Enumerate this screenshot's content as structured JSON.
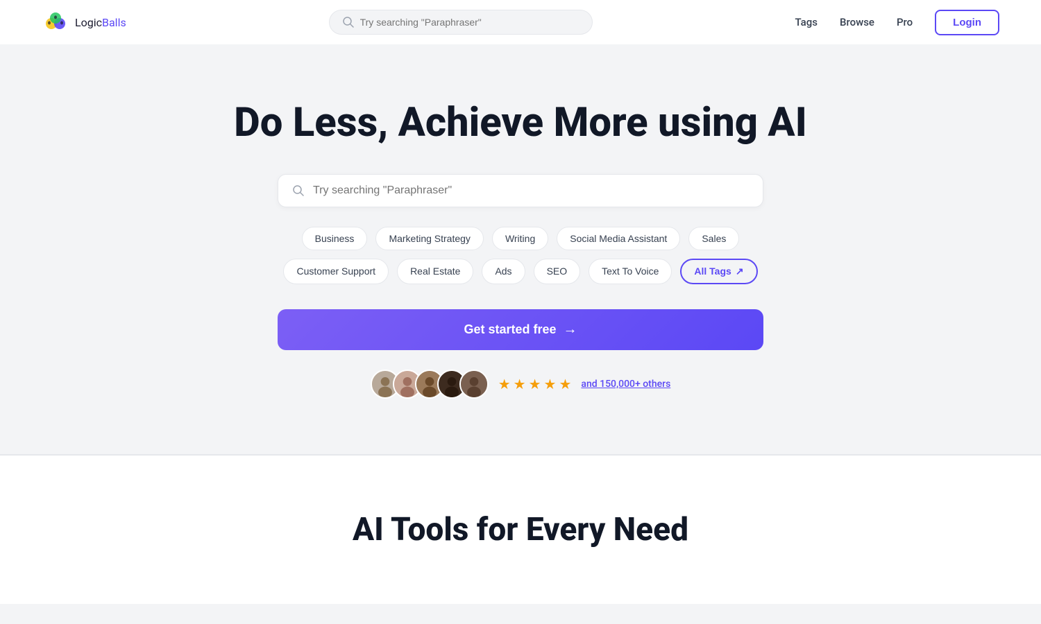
{
  "brand": {
    "logic": "Logic",
    "balls": "Balls",
    "tagline": "LogicBalls"
  },
  "navbar": {
    "search_placeholder": "Try searching \"Paraphraser\"",
    "links": [
      {
        "id": "tags",
        "label": "Tags"
      },
      {
        "id": "browse",
        "label": "Browse"
      },
      {
        "id": "pro",
        "label": "Pro"
      }
    ],
    "login_label": "Login"
  },
  "hero": {
    "title": "Do Less, Achieve More using AI",
    "search_placeholder": "Try searching \"Paraphraser\"",
    "tags": [
      {
        "id": "business",
        "label": "Business",
        "active": false
      },
      {
        "id": "marketing-strategy",
        "label": "Marketing Strategy",
        "active": false
      },
      {
        "id": "writing",
        "label": "Writing",
        "active": false
      },
      {
        "id": "social-media",
        "label": "Social Media Assistant",
        "active": false
      },
      {
        "id": "sales",
        "label": "Sales",
        "active": false
      },
      {
        "id": "customer-support",
        "label": "Customer Support",
        "active": false
      },
      {
        "id": "real-estate",
        "label": "Real Estate",
        "active": false
      },
      {
        "id": "ads",
        "label": "Ads",
        "active": false
      },
      {
        "id": "seo",
        "label": "SEO",
        "active": false
      },
      {
        "id": "text-to-voice",
        "label": "Text To Voice",
        "active": false
      },
      {
        "id": "all-tags",
        "label": "All Tags",
        "active": true
      }
    ],
    "cta_label": "Get started free",
    "cta_arrow": "→",
    "social_proof_text": "and 150,000+ others",
    "avatars": [
      {
        "id": 1,
        "initials": ""
      },
      {
        "id": 2,
        "initials": ""
      },
      {
        "id": 3,
        "initials": ""
      },
      {
        "id": 4,
        "initials": ""
      },
      {
        "id": 5,
        "initials": ""
      }
    ],
    "stars": [
      "★",
      "★",
      "★",
      "★",
      "★"
    ]
  },
  "section_two": {
    "title": "AI Tools for Every Need"
  }
}
